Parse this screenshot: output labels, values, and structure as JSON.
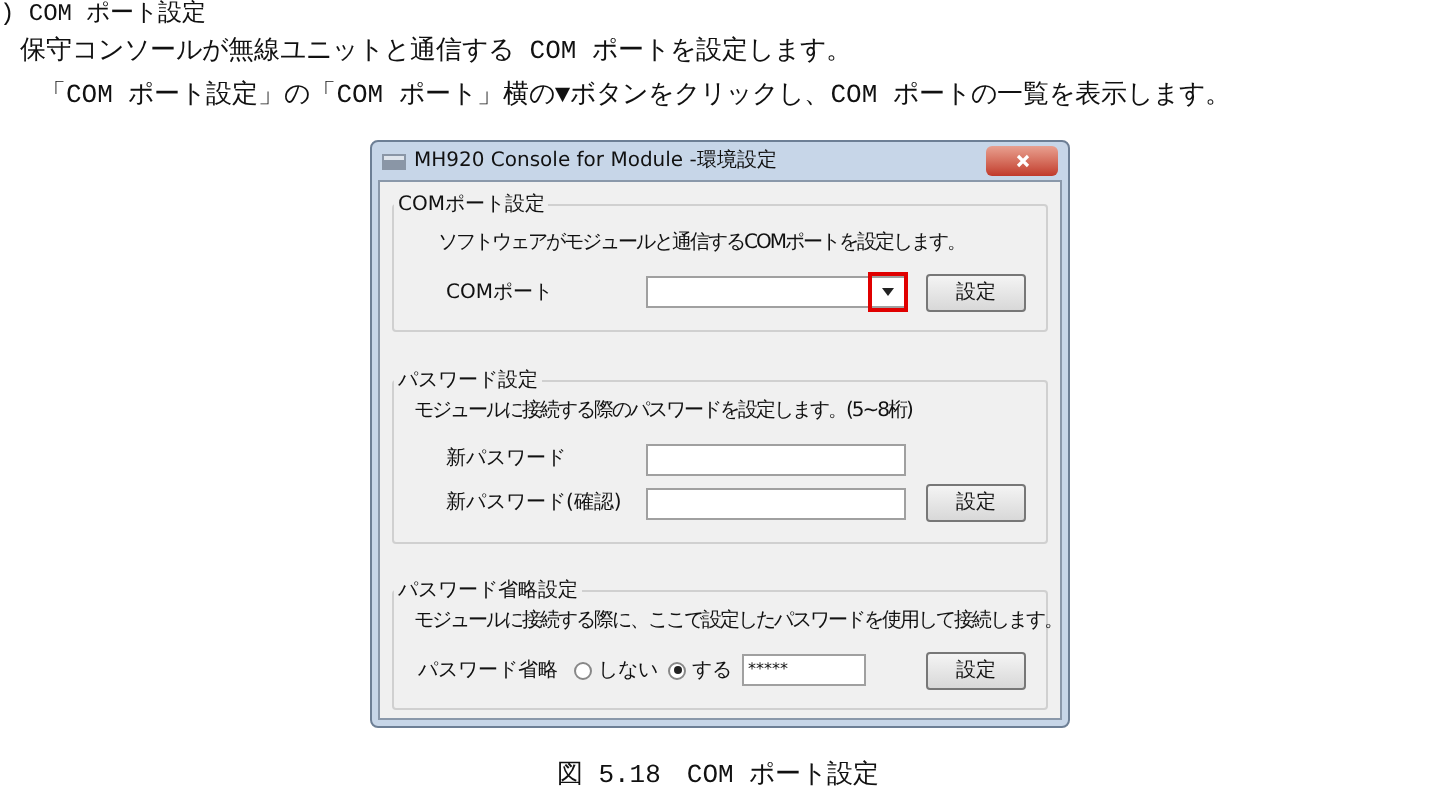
{
  "document": {
    "heading": ") COM ポート設定",
    "paragraphs": [
      "保守コンソールが無線ユニットと通信する COM ポートを設定します。",
      "「COM ポート設定」の「COM ポート」横の▼ボタンをクリックし、COM ポートの一覧を表示します。"
    ]
  },
  "window": {
    "title": "MH920 Console for Module -環境設定"
  },
  "groups": [
    {
      "legend": "COMポート設定",
      "description": "ソフトウェアがモジュールと通信するCOMポートを設定します。",
      "fields": [
        {
          "kind": "combo",
          "label": "COMポート",
          "highlighted": true
        }
      ],
      "button": "設定"
    },
    {
      "legend": "パスワード設定",
      "description": "モジュールに接続する際のパスワードを設定します。(5~8桁)",
      "fields": [
        {
          "kind": "text",
          "label": "新パスワード"
        },
        {
          "kind": "text",
          "label": "新パスワード(確認)"
        }
      ],
      "button": "設定"
    },
    {
      "legend": "パスワード省略設定",
      "description": "モジュールに接続する際に、ここで設定したパスワードを使用して接続します。",
      "fields": [
        {
          "kind": "radio",
          "label": "パスワード省略",
          "options": [
            {
              "label": "しない",
              "selected": false
            },
            {
              "label": "する",
              "selected": true
            }
          ],
          "value": "*****"
        }
      ],
      "button": "設定"
    }
  ],
  "caption": "図 5.18　COM ポート設定"
}
